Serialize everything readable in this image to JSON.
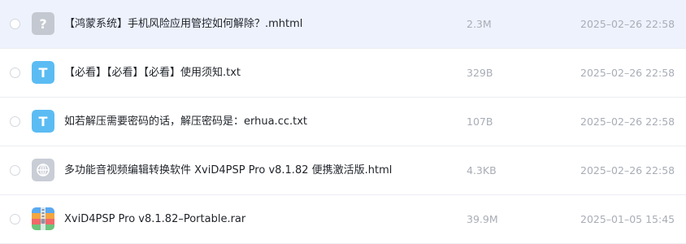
{
  "files": [
    {
      "name": "【鸿蒙系统】手机风险应用管控如何解除？.mhtml",
      "size": "2.3M",
      "date": "2025–02–26 22:58",
      "icon": "unknown-file-icon",
      "selected": true
    },
    {
      "name": "【必看】【必看】【必看】使用须知.txt",
      "size": "329B",
      "date": "2025–02–26 22:58",
      "icon": "text-file-icon",
      "selected": false
    },
    {
      "name": "如若解压需要密码的话，解压密码是：erhua.cc.txt",
      "size": "107B",
      "date": "2025–02–26 22:58",
      "icon": "text-file-icon",
      "selected": false
    },
    {
      "name": "多功能音视频编辑转换软件 XviD4PSP Pro v8.1.82 便携激活版.html",
      "size": "4.3KB",
      "date": "2025–02–26 22:58",
      "icon": "web-file-icon",
      "selected": false
    },
    {
      "name": "XviD4PSP Pro v8.1.82–Portable.rar",
      "size": "39.9M",
      "date": "2025–01–05 15:45",
      "icon": "archive-file-icon",
      "selected": false
    }
  ],
  "colors": {
    "highlight_row": "#eef2fd",
    "text_icon": "#5bbcf3",
    "unknown_icon": "#c4c8d0",
    "web_icon": "#c9cdd6",
    "secondary_text": "#a8adb6"
  }
}
